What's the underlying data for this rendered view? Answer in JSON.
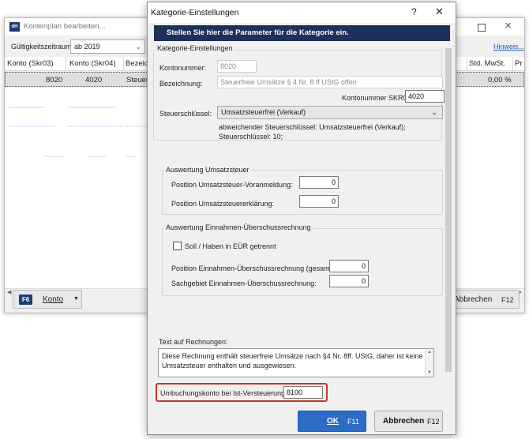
{
  "background_window": {
    "title": "Kontenplan bearbeiten...",
    "app_icon": "app-logo-icon",
    "period_label": "Gültigkeitszeitraum:",
    "period_value": "ab 2019",
    "hint_link": "Hinweis...",
    "columns": [
      "Konto (Skr03)",
      "Konto (Skr04)",
      "Bezeic",
      "Std. MwSt.",
      "Pr"
    ],
    "row": {
      "skr03": "8020",
      "skr04": "4020",
      "bezeichnung": "Steuer",
      "mwst": "0,00 %"
    },
    "konto_button": {
      "key": "F6",
      "label": "Konto"
    },
    "cancel_button": {
      "label": "Abbrechen",
      "key": "F12"
    }
  },
  "dialog": {
    "title": "Kategorie-Einstellungen",
    "help": "?",
    "close": "✕",
    "banner": "Stellen Sie hier die Parameter für die Kategorie ein.",
    "section_main": "Kategorie-Einstellungen",
    "kontonummer_label": "Kontonummer:",
    "kontonummer_value": "8020",
    "bezeichnung_label": "Bezeichnung:",
    "bezeichnung_value": "Steuerfreie Umsätze § 4 Nr. 8 ff UStG offen",
    "skr04_label": "Kontonummer SKR04:",
    "skr04_value": "4020",
    "steuer_label": "Steuerschlüssel:",
    "steuer_value": "Umsatzsteuerfrei (Verkauf)",
    "steuer_note": "abweichender Steuerschlüssel: Umsatzsteuerfrei (Verkauf); Steuerschlüssel: 10;",
    "ust_group": {
      "title": "Auswertung Umsatzsteuer",
      "voranmeldung_label": "Position Umsatzsteuer-Voranmeldung:",
      "voranmeldung_value": "0",
      "erklaerung_label": "Position Umsatzsteuererklärung:",
      "erklaerung_value": "0"
    },
    "eur_group": {
      "title": "Auswertung Einnahmen-Überschussrechnung",
      "soll_haben_label": "Soll / Haben in EÜR getrennt",
      "soll_haben_checked": false,
      "position_label": "Position Einnahmen-Überschussrechnung (gesamt):",
      "position_value": "0",
      "sachgebiet_label": "Sachgebiet Einnahmen-Überschussrechnung:",
      "sachgebiet_value": "0"
    },
    "invoice_text_label": "Text auf Rechnungen:",
    "invoice_text": "Diese Rechnung enthält steuerfreie Umsätze nach §4 Nr. 8ff. UStG, daher ist keine Umsatzsteuer enthalten und ausgewiesen.",
    "umbuchung_label": "Umbuchungskonto bei Ist-Versteuerung:",
    "umbuchung_value": "8100",
    "ok_button": {
      "label": "OK",
      "key": "F11"
    },
    "cancel_button": {
      "label": "Abbrechen",
      "key": "F12"
    }
  },
  "colors": {
    "banner_bg": "#1f2f5c",
    "ok_bg": "#2c6bc6",
    "highlight_border": "#c0392b",
    "fkey_bg": "#1f3d7a",
    "link": "#1a5cb8"
  }
}
